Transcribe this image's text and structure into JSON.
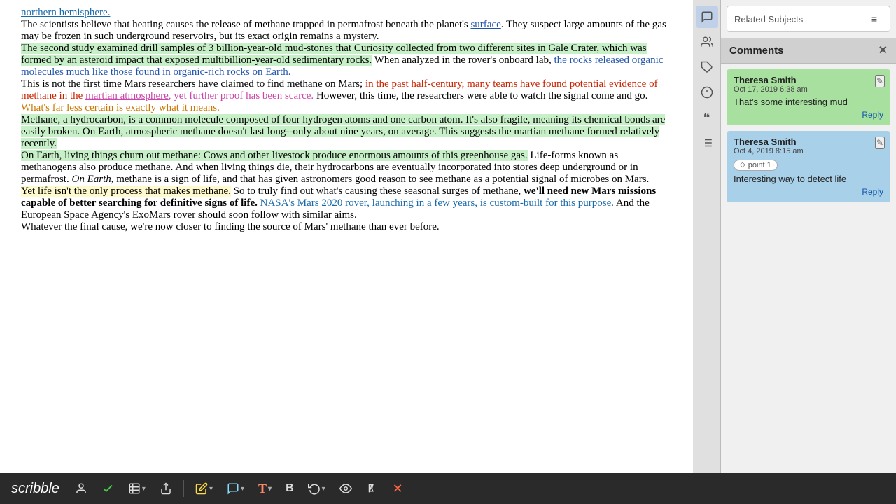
{
  "toolbar": {
    "brand": "scribble",
    "buttons": [
      {
        "id": "user",
        "icon": "👤",
        "label": "User",
        "has_caret": false
      },
      {
        "id": "check",
        "icon": "✅",
        "label": "Check",
        "has_caret": false
      },
      {
        "id": "library",
        "icon": "🏛",
        "label": "Library",
        "has_caret": true
      },
      {
        "id": "share",
        "icon": "📤",
        "label": "Share",
        "has_caret": false
      },
      {
        "id": "highlight",
        "icon": "✏",
        "label": "Highlight",
        "has_caret": true
      },
      {
        "id": "comment",
        "icon": "💬",
        "label": "Comment",
        "has_caret": true
      },
      {
        "id": "text",
        "icon": "T",
        "label": "Text",
        "has_caret": true
      },
      {
        "id": "bold",
        "icon": "B",
        "label": "Bold",
        "has_caret": false
      },
      {
        "id": "undo",
        "icon": "↩",
        "label": "Undo",
        "has_caret": true
      },
      {
        "id": "view",
        "icon": "👁",
        "label": "View",
        "has_caret": false
      },
      {
        "id": "flag",
        "icon": "📢",
        "label": "Flag",
        "has_caret": false
      },
      {
        "id": "close",
        "icon": "✕",
        "label": "Close",
        "has_caret": false
      }
    ]
  },
  "article": {
    "paragraphs": [
      {
        "id": "p1",
        "text": "northern hemisphere."
      },
      {
        "id": "p2",
        "text": "The scientists believe that heating causes the release of methane trapped in permafrost beneath the planet's surface. They suspect large amounts of the gas may be frozen in such underground reservoirs, but its exact origin remains a mystery."
      },
      {
        "id": "p3",
        "text": "The second study examined drill samples of 3 billion-year-old mud-stones that Curiosity collected from two different sites in Gale Crater, which was formed by an asteroid impact that exposed multibillion-year-old sedimentary rocks. When analyzed in the rover's onboard lab, the rocks released organic molecules much like those found in organic-rich rocks on Earth."
      },
      {
        "id": "p4",
        "text": "This is not the first time Mars researchers have claimed to find methane on Mars; in the past half-century, many teams have found potential evidence of methane in the martian atmosphere, yet further proof has been scarce. However, this time, the researchers were able to watch the signal come and go. What's far less certain is exactly what it means."
      },
      {
        "id": "p5",
        "text": "Methane, a hydrocarbon, is a common molecule composed of four hydrogen atoms and one carbon atom. It's also fragile, meaning its chemical bonds are easily broken. On Earth, atmospheric methane doesn't last long--only about nine years, on average. This suggests the martian methane formed relatively recently."
      },
      {
        "id": "p6",
        "text": "On Earth, living things churn out methane: Cows and other livestock produce enormous amounts of this greenhouse gas. Life-forms known as methanogens also produce methane. And when living things die, their hydrocarbons are eventually incorporated into stores deep underground or in permafrost. On Earth, methane is a sign of life, and that has given astronomers good reason to see methane as a potential signal of microbes on Mars."
      },
      {
        "id": "p7",
        "text": "Yet life isn't the only process that makes methane. So to truly find out what's causing these seasonal surges of methane, we'll need new Mars missions capable of better searching for definitive signs of life. NASA's Mars 2020 rover, launching in a few years, is custom-built for this purpose. And the European Space Agency's ExoMars rover should soon follow with similar aims."
      },
      {
        "id": "p8",
        "text": "Whatever the final cause, we're now closer to finding the source of Mars' methane than ever before."
      }
    ]
  },
  "related_subjects": {
    "title": "Related Subjects",
    "icon": "≡"
  },
  "sidebar_icons": [
    {
      "id": "chat",
      "icon": "💬",
      "label": "Chat"
    },
    {
      "id": "users",
      "icon": "👥",
      "label": "Users"
    },
    {
      "id": "tag",
      "icon": "🏷",
      "label": "Tag"
    },
    {
      "id": "info",
      "icon": "ℹ",
      "label": "Info"
    },
    {
      "id": "quote",
      "icon": "❝",
      "label": "Quote"
    },
    {
      "id": "list",
      "icon": "≡",
      "label": "List"
    }
  ],
  "comments": {
    "title": "Comments",
    "close_label": "✕",
    "items": [
      {
        "id": "comment1",
        "author": "Theresa Smith",
        "date": "Oct 17, 2019 6:38 am",
        "tag": null,
        "text": "That's some interesting mud",
        "reply_label": "Reply",
        "color": "green"
      },
      {
        "id": "comment2",
        "author": "Theresa Smith",
        "date": "Oct 4, 2019 8:15 am",
        "tag": "point 1",
        "text": "Interesting way to detect life",
        "reply_label": "Reply",
        "color": "blue"
      }
    ]
  }
}
